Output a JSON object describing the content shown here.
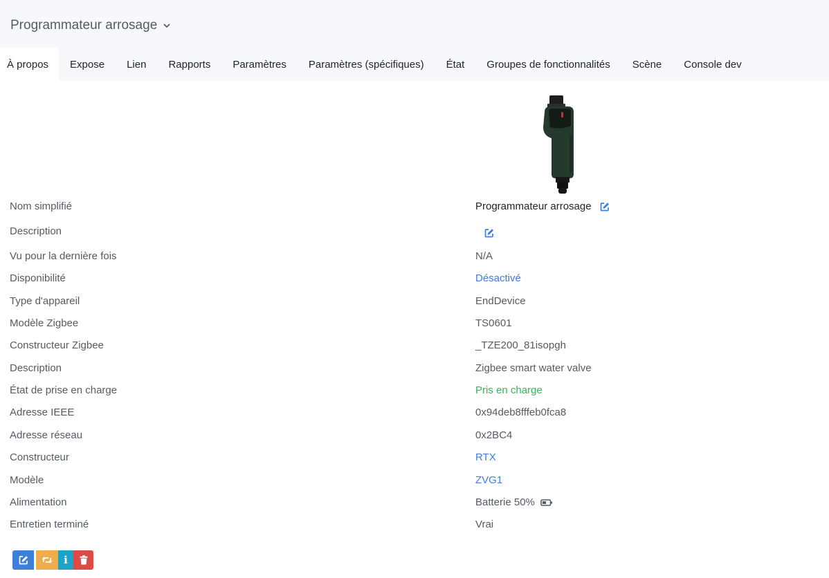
{
  "header": {
    "title": "Programmateur arrosage"
  },
  "tabs": [
    {
      "label": "À propos",
      "active": true
    },
    {
      "label": "Expose"
    },
    {
      "label": "Lien"
    },
    {
      "label": "Rapports"
    },
    {
      "label": "Paramètres"
    },
    {
      "label": "Paramètres (spécifiques)"
    },
    {
      "label": "État"
    },
    {
      "label": "Groupes de fonctionnalités"
    },
    {
      "label": "Scène"
    },
    {
      "label": "Console dev"
    }
  ],
  "details": {
    "friendly_name": {
      "label": "Nom simplifié",
      "value": "Programmateur arrosage"
    },
    "description_user": {
      "label": "Description",
      "value": ""
    },
    "last_seen": {
      "label": "Vu pour la dernière fois",
      "value": "N/A"
    },
    "availability": {
      "label": "Disponibilité",
      "value": "Désactivé"
    },
    "device_type": {
      "label": "Type d'appareil",
      "value": "EndDevice"
    },
    "zigbee_model": {
      "label": "Modèle Zigbee",
      "value": "TS0601"
    },
    "zigbee_manufacturer": {
      "label": "Constructeur Zigbee",
      "value": "_TZE200_81isopgh"
    },
    "description": {
      "label": "Description",
      "value": "Zigbee smart water valve"
    },
    "support_status": {
      "label": "État de prise en charge",
      "value": "Pris en charge"
    },
    "ieee_address": {
      "label": "Adresse IEEE",
      "value": "0x94deb8fffeb0fca8"
    },
    "network_address": {
      "label": "Adresse réseau",
      "value": "0x2BC4"
    },
    "manufacturer": {
      "label": "Constructeur",
      "value": "RTX"
    },
    "model": {
      "label": "Modèle",
      "value": "ZVG1"
    },
    "power": {
      "label": "Alimentation",
      "value": "Batterie 50%",
      "icon": "battery-half-icon"
    },
    "interview_completed": {
      "label": "Entretien terminé",
      "value": "Vrai"
    }
  },
  "actions": {
    "rename_icon": "edit-icon",
    "reconfigure_icon": "retweet-icon",
    "interview_icon": "info-icon",
    "remove_icon": "trash-icon",
    "info_glyph": "i"
  },
  "colors": {
    "primary": "#3d7fd9",
    "warning": "#f0ad4e",
    "info": "#1fa2c8",
    "danger": "#dc4b48",
    "success": "#39b458",
    "header_bg": "#f7f8fb"
  }
}
